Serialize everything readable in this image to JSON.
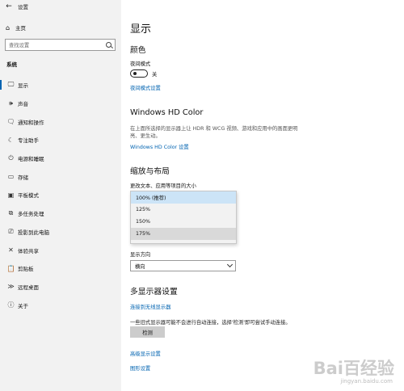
{
  "window": {
    "title": "设置"
  },
  "sidebar": {
    "home_label": "主页",
    "search_placeholder": "查找设置",
    "section_label": "系统",
    "items": [
      {
        "label": "显示",
        "icon": "monitor-icon",
        "glyph": "🖵"
      },
      {
        "label": "声音",
        "icon": "speaker-icon",
        "glyph": "🕪"
      },
      {
        "label": "通知和操作",
        "icon": "notification-icon",
        "glyph": "🗨"
      },
      {
        "label": "专注助手",
        "icon": "moon-icon",
        "glyph": "☾"
      },
      {
        "label": "电源和睡眠",
        "icon": "power-icon",
        "glyph": "⏻"
      },
      {
        "label": "存储",
        "icon": "storage-icon",
        "glyph": "▭"
      },
      {
        "label": "平板模式",
        "icon": "tablet-icon",
        "glyph": "▣"
      },
      {
        "label": "多任务处理",
        "icon": "multitask-icon",
        "glyph": "⧉"
      },
      {
        "label": "投影到此电脑",
        "icon": "project-icon",
        "glyph": "⎚"
      },
      {
        "label": "体验共享",
        "icon": "share-icon",
        "glyph": "✕"
      },
      {
        "label": "剪贴板",
        "icon": "clipboard-icon",
        "glyph": "📋"
      },
      {
        "label": "远程桌面",
        "icon": "remote-icon",
        "glyph": "≫"
      },
      {
        "label": "关于",
        "icon": "info-icon",
        "glyph": "ⓘ"
      }
    ]
  },
  "main": {
    "title": "显示",
    "color_heading": "颜色",
    "night_mode_label": "夜间模式",
    "night_mode_state": "关",
    "night_mode_link": "夜间模式设置",
    "hd_heading": "Windows HD Color",
    "hd_desc": "在上面所选择的显示器上让 HDR 和 WCG 视频、游戏和应用中的画面更明亮、更生动。",
    "hd_link": "Windows HD Color 设置",
    "scale_heading": "缩放与布局",
    "scale_label": "更改文本、应用等项目的大小",
    "scale_options": [
      "100% (推荐)",
      "125%",
      "150%",
      "175%"
    ],
    "orientation_label": "显示方向",
    "orientation_value": "横向",
    "multi_heading": "多显示器设置",
    "wireless_link": "连接到无线显示器",
    "detect_desc": "一些旧式显示器可能不会进行自动连接，选择'检测'即可尝试手动连接。",
    "detect_button": "检测",
    "advanced_link": "高级显示设置",
    "graphics_link": "图形设置"
  },
  "watermark": {
    "main": "Bai百经验",
    "sub": "jingyan.baidu.com"
  },
  "colors": {
    "accent": "#0063b1",
    "sidebar_bg": "#f2f2f2"
  }
}
